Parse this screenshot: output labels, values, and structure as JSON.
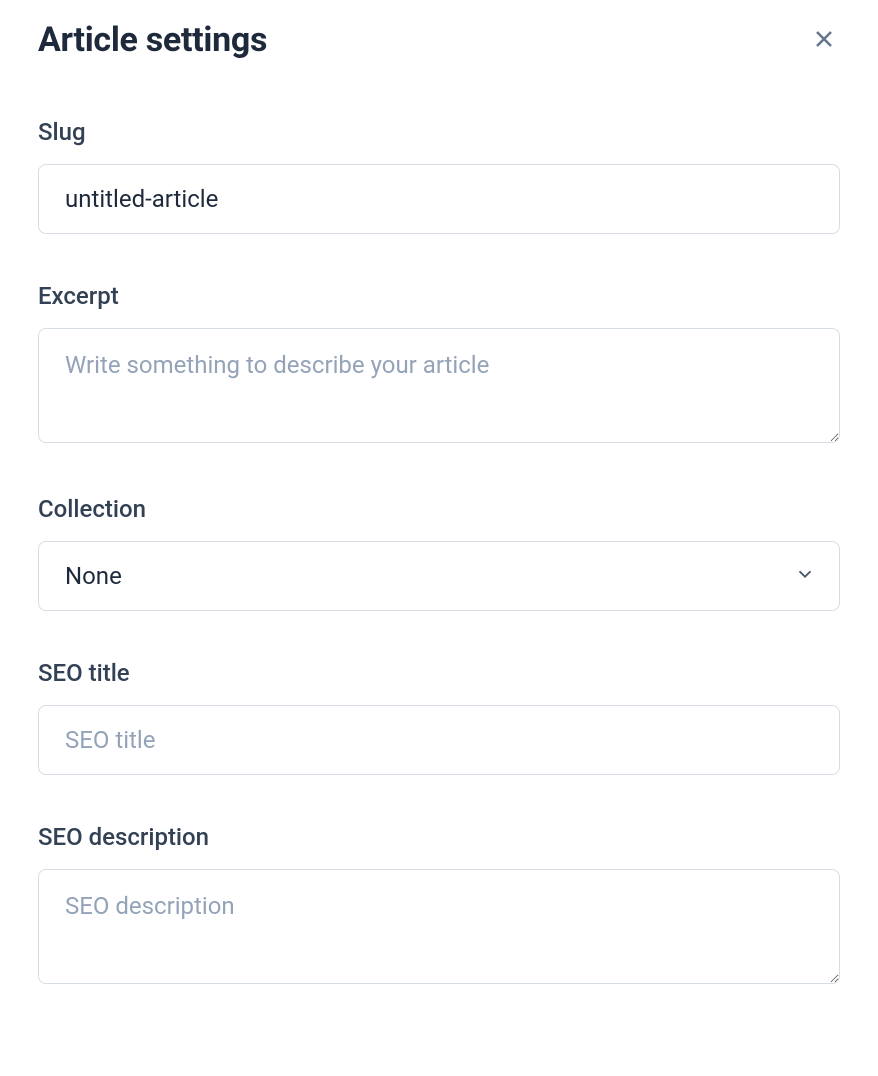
{
  "header": {
    "title": "Article settings"
  },
  "fields": {
    "slug": {
      "label": "Slug",
      "value": "untitled-article"
    },
    "excerpt": {
      "label": "Excerpt",
      "placeholder": "Write something to describe your article",
      "value": ""
    },
    "collection": {
      "label": "Collection",
      "selected": "None"
    },
    "seo_title": {
      "label": "SEO title",
      "placeholder": "SEO title",
      "value": ""
    },
    "seo_description": {
      "label": "SEO description",
      "placeholder": "SEO description",
      "value": ""
    }
  }
}
